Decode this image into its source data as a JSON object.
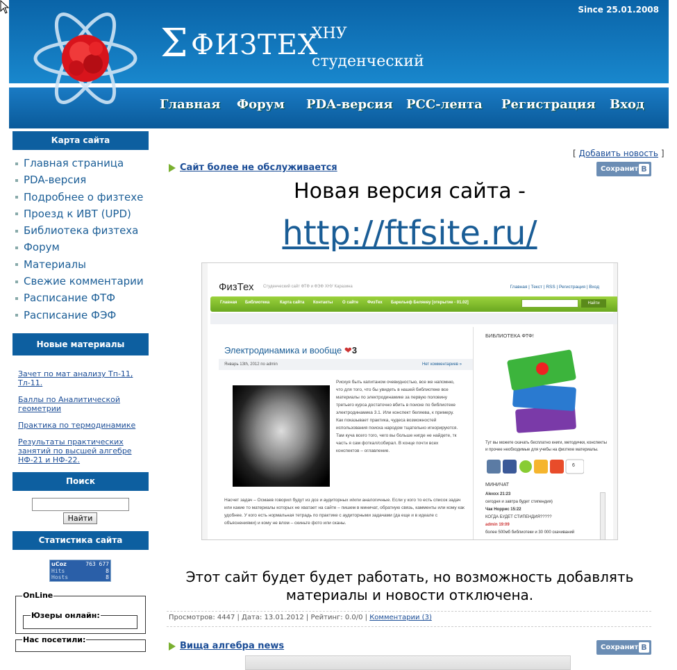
{
  "header": {
    "since": "Since 25.01.2008",
    "sigma": "Σ",
    "site_name": "ФИЗТЕХ",
    "subtitle_1": "ХНУ",
    "subtitle_2": "студенческий",
    "nav": [
      "Главная",
      "Форум",
      "PDA-версия",
      "PCC-лента",
      "Регистрация",
      "Вход"
    ]
  },
  "sidebar": {
    "sitemap_title": "Карта сайта",
    "sitemap_items": [
      "Главная страница",
      "PDA-версия",
      "Подробнее о физтехе",
      "Проезд к ИВТ (UPD)",
      "Библиотека физтеха",
      "Форум",
      "Материалы",
      "Свежие комментарии",
      "Расписание ФТФ",
      "Расписание ФЭФ"
    ],
    "new_materials_title": "Новые материалы",
    "new_materials": [
      "Зачет по мат анализу Тп-11, Тл-11.",
      "Баллы по Аналитической геометрии",
      "Практика по термодинамике",
      "Результаты практических занятий по высшей алгебре НФ-21 и НФ-22."
    ],
    "search_title": "Поиск",
    "search_button": "Найти",
    "stats_title": "Статистика сайта",
    "counter": {
      "brand": "uCoz",
      "total": "763 677",
      "hits_label": "Hits",
      "hits": "8",
      "hosts_label": "Hosts",
      "hosts": "8"
    },
    "online_legend": "OnLine",
    "users_online_legend": "Юзеры онлайн:",
    "visited_legend": "Нас посетили:"
  },
  "main": {
    "add_news_open": "[",
    "add_news": "Добавить новость",
    "add_news_close": "]",
    "post1_title": "Сайт более не обслуживается",
    "save_label": "Сохранить",
    "save_vk": "B",
    "headline": "Новая версия сайта -",
    "link": "http://ftfsite.ru/",
    "notice": "Этот сайт будет будет работать, но возможность добавлять материалы и новости отключена.",
    "meta_prefix": "Просмотров: 4447 | Дата: 13.01.2012 | Рейтинг: 0.0/0 |",
    "meta_comments": "Комментарии (3)",
    "post2_title": "Вища алгебра news"
  },
  "screenshot": {
    "title": "ФизТех",
    "title_sub": "Студенческий сайт ФТФ и ФЭФ ХНУ Каразина",
    "top_links": "Главная | Текст | RSS | Регистрация | Вход",
    "green_nav": [
      "Главная",
      "Библиотека",
      "Карта сайта",
      "Контакты",
      "О сайте",
      "ФизТех",
      "Барельеф Беляеву [открытие - 01.02]"
    ],
    "search_btn": "Найти",
    "post_title": "Электродинамика и вообще",
    "post_likes": "3",
    "post_meta": "Январь 13th, 2012 по admin",
    "post_comments": "Нет комментариев »",
    "post_text": "Рискуя быть капитаном очевидностью, все же напомню, что для того, что бы увидеть в нашей библиотеке все материалы по электродинамике за первую половину третьего курса достаточно вбить в поиске по библиотеке электродинамика 3.1. Или конспект беляева, к примеру. Как показывает практика, чудеса возможностей использования поиска народом тщательно игнорируются. Там куча всего того, чего вы больше нигде не найдете, тк часть я сам фоткал/собирал. В конце почти всех конспектов – оглавление.",
    "post_text_2": "Насчет задач – Осмаев говорил будут из доз и аудиторных и/или аналогичные. Если у кого то есть список задач или какие то материалы которых не хватает на сайте – пишем в миничат, обратную связь, камменты или кому как удобнее. У кого есть нормальная тетрадь по практике с аудиторными задачами (да еще и в идеале с объяснениями) и кому не влом – скиньте фото или сканы.",
    "lib_title": "БИБЛИОТЕКА ФТФ!",
    "lib_text": "Тут вы можете скачать бесплатно книги, методички, конспекты и прочее необходимые для учебы на физтехе материалы.",
    "social_count": "6",
    "minichat": "МИНИЧАТ",
    "chat": [
      "Alexxx 21:23",
      "сегодня и завтра будет стипендия)",
      "Чак Норрис 15:22",
      "КОГДА БУДЕТ СТИПЕНДИЯ?????",
      "admin 19:09",
      "более 500мб библиотеки и 30 000 скачиваний"
    ]
  }
}
